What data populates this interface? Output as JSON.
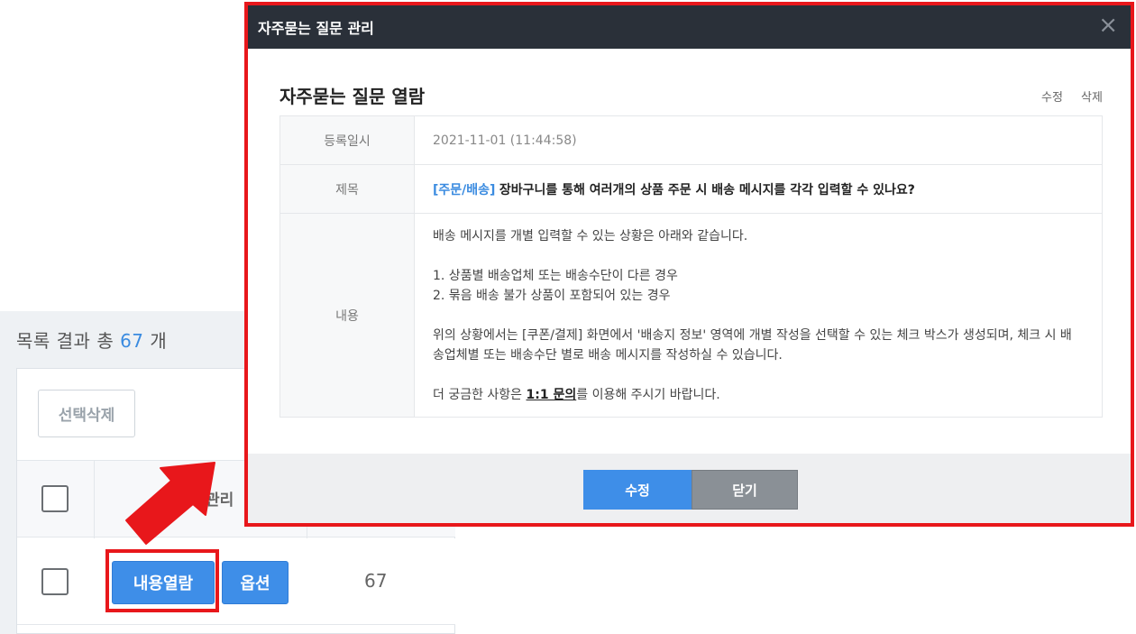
{
  "list": {
    "result_prefix": "목록 결과 총",
    "result_count": "67",
    "result_suffix": "개",
    "delete_selected_label": "선택삭제",
    "header_col_label": "관리",
    "row": {
      "view_button_label": "내용열람",
      "option_button_label": "옵션",
      "number": "67"
    }
  },
  "modal": {
    "header_title": "자주묻는 질문 관리",
    "close_symbol": "×",
    "view_title": "자주묻는 질문 열람",
    "edit_link": "수정",
    "delete_link": "삭제",
    "rows": {
      "date_label": "등록일시",
      "date_value": "2021-11-01 (11:44:58)",
      "subject_label": "제목",
      "subject_category": "[주문/배송]",
      "subject_text": "장바구니를 통해 여러개의 상품 주문 시 배송 메시지를 각각 입력할 수 있나요?",
      "content_label": "내용"
    },
    "content": {
      "line1": "배송 메시지를 개별 입력할 수 있는 상황은 아래와 같습니다.",
      "line2": "1. 상품별 배송업체 또는 배송수단이 다른 경우",
      "line3": "2. 묶음 배송 불가 상품이 포함되어 있는 경우",
      "line4": "위의 상황에서는 [쿠폰/결제] 화면에서 '배송지 정보' 영역에 개별 작성을 선택할 수 있는 체크 박스가 생성되며, 체크 시 배송업체별 또는 배송수단 별로 배송 메시지를 작성하실 수 있습니다.",
      "line5_prefix": "더 궁금한 사항은 ",
      "line5_link": "1:1 문의",
      "line5_suffix": "를 이용해 주시기 바랍니다."
    },
    "footer": {
      "edit_button_label": "수정",
      "close_button_label": "닫기"
    }
  },
  "colors": {
    "accent_blue": "#3e8ee8",
    "highlight_red": "#e8171b",
    "modal_header": "#2a3039"
  },
  "icons": {
    "arrow": "arrow-pointer-icon",
    "close": "close-icon"
  }
}
